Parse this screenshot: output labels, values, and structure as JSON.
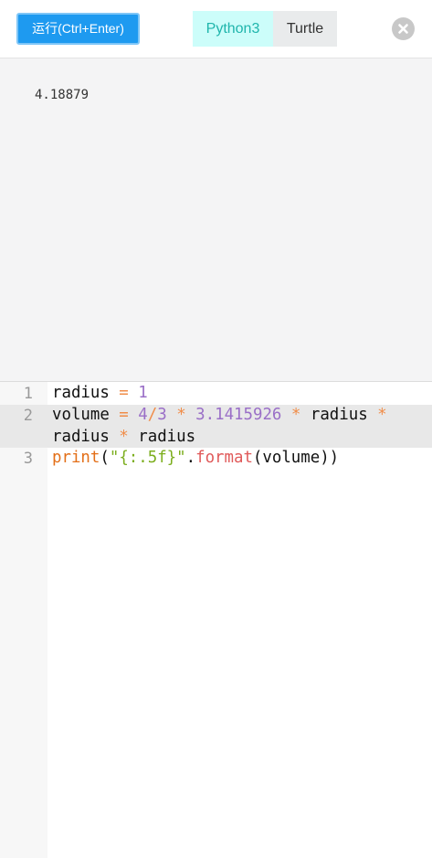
{
  "toolbar": {
    "run_label": "运行(Ctrl+Enter)",
    "tabs": [
      {
        "label": "Python3",
        "active": true
      },
      {
        "label": "Turtle",
        "active": false
      }
    ],
    "close_icon": "close-icon"
  },
  "output": {
    "text": "4.18879"
  },
  "editor": {
    "line_numbers": [
      "1",
      "2",
      "3"
    ],
    "lines": [
      "radius = 1",
      "volume = 4/3 * 3.1415926 * radius * radius * radius",
      "print(\"{:.5f}\".format(volume))"
    ],
    "active_line": 2
  },
  "colors": {
    "run_button": "#1e9af0",
    "active_tab_bg": "#ccfdfa",
    "active_tab_text": "#1fb5ac",
    "output_bg": "#f4f4f5",
    "operator": "#f08d49",
    "number": "#9a6fc7",
    "keyword": "#e36f18",
    "string": "#7cae1e",
    "method": "#e05a5a"
  }
}
